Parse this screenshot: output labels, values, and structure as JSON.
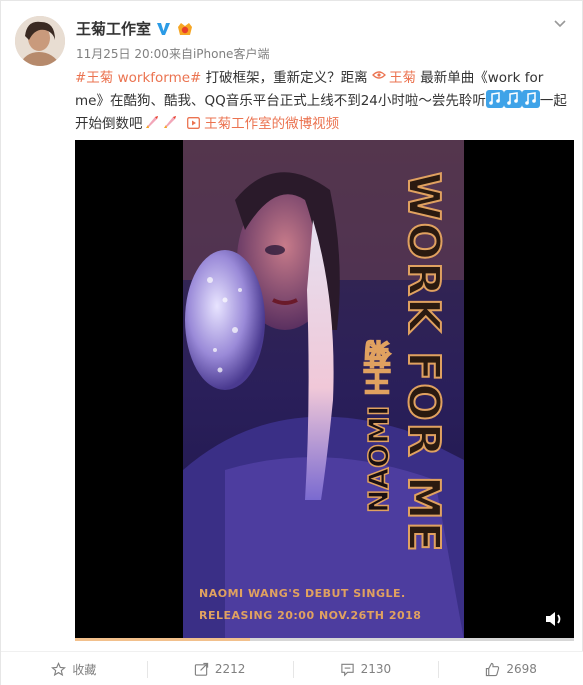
{
  "user": {
    "name": "王菊工作室",
    "date": "11月25日 20:00",
    "source": "来自iPhone客户端"
  },
  "post": {
    "hashtag": "#王菊 workforme#",
    "text1": " 打破框架，重新定义？距离 ",
    "mention": "王菊",
    "text2": " 最新单曲《work for me》在酷狗、酷我、QQ音乐平台正式上线不到24小时啦～尝先聆听",
    "text3": "一起开始倒数吧",
    "video_link": "王菊工作室的微博视频"
  },
  "video": {
    "title": "WORK FOR ME",
    "artist": "NAOMI 王菊",
    "line1": "NAOMI WANG'S DEBUT SINGLE.",
    "line2": "RELEASING 20:00 NOV.26TH 2018",
    "progress": 0.35
  },
  "actions": {
    "favorite": "收藏",
    "repost": "2212",
    "comment": "2130",
    "like": "2698"
  },
  "colors": {
    "link": "#eb7350",
    "poster_gold": "#e0a160",
    "meta": "#808080"
  }
}
